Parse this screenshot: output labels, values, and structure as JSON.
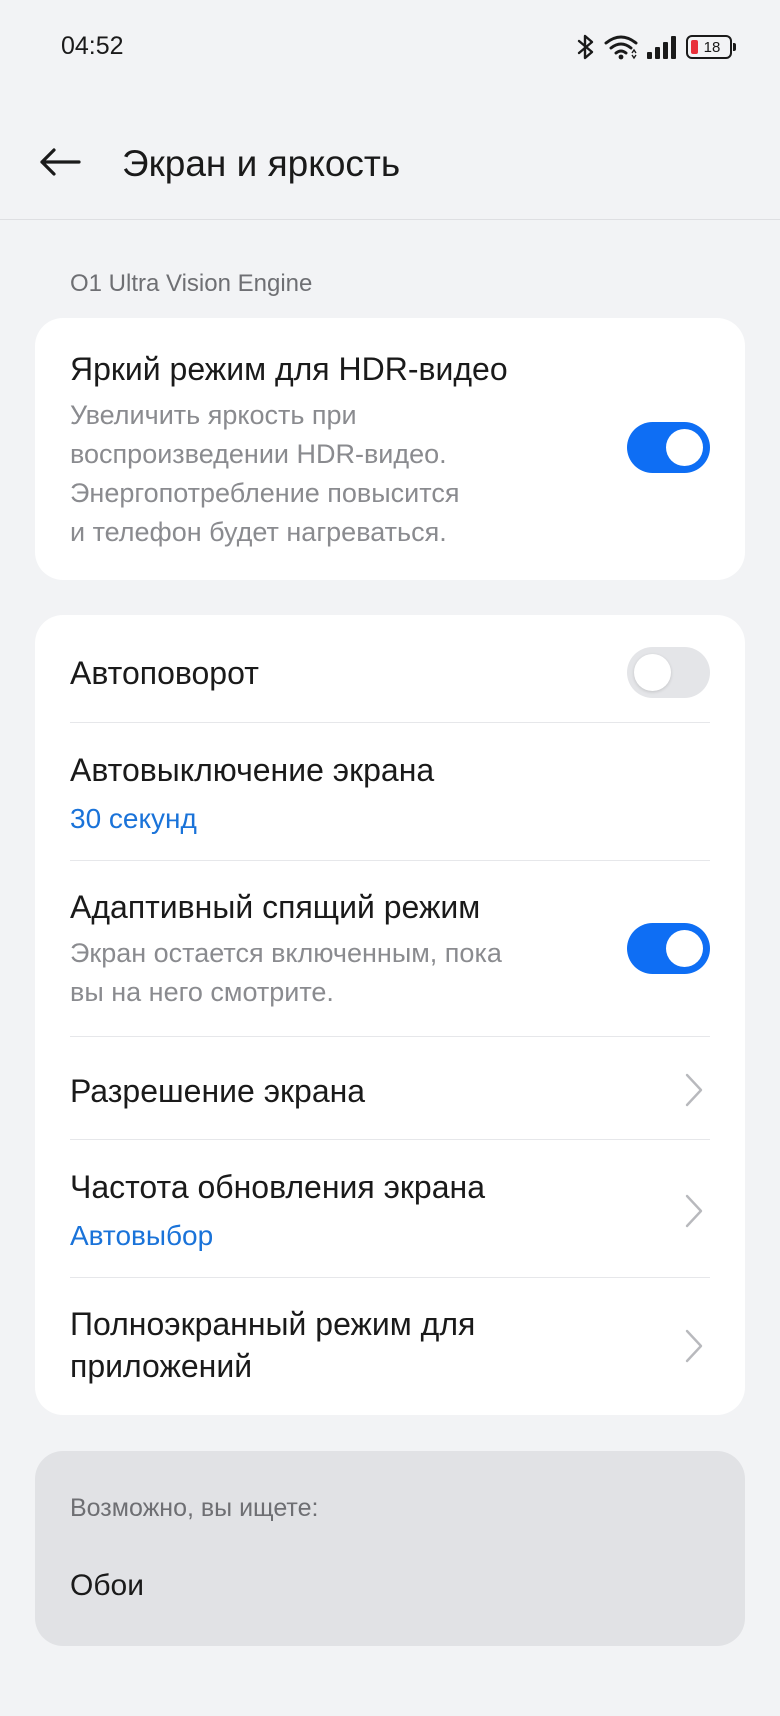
{
  "status_bar": {
    "time": "04:52",
    "battery_level": "18",
    "battery_color": "#e8303a",
    "icons": [
      "bluetooth-icon",
      "wifi-icon",
      "signal-icon",
      "battery-icon"
    ]
  },
  "header": {
    "back_icon": "back-arrow-icon",
    "title": "Экран и яркость"
  },
  "section_engine": {
    "header": "O1 Ultra Vision Engine"
  },
  "hdr_card": {
    "title": "Яркий режим для HDR-видео",
    "description_lines": [
      "Увеличить яркость при",
      "воспроизведении HDR-видео.",
      "Энергопотребление повысится",
      "и телефон будет нагреваться."
    ],
    "toggle_on": true
  },
  "settings": {
    "auto_rotate": {
      "title": "Автоповорот",
      "toggle_on": false
    },
    "screen_timeout": {
      "title": "Автовыключение экрана",
      "value": "30 секунд"
    },
    "adaptive_sleep": {
      "title": "Адаптивный спящий режим",
      "description_lines": [
        "Экран остается включенным, пока",
        "вы на него смотрите."
      ],
      "toggle_on": true
    },
    "resolution": {
      "title": "Разрешение экрана"
    },
    "refresh_rate": {
      "title": "Частота обновления экрана",
      "value": "Автовыбор"
    },
    "fullscreen_apps": {
      "title_lines": [
        "Полноэкранный режим для",
        "приложений"
      ]
    }
  },
  "suggestions": {
    "header": "Возможно, вы ищете:",
    "items": [
      "Обои"
    ]
  },
  "colors": {
    "accent": "#0e6ef4",
    "value_text": "#1a73d9",
    "background": "#f2f3f5",
    "card": "#ffffff",
    "suggest_card": "#e1e2e5"
  }
}
